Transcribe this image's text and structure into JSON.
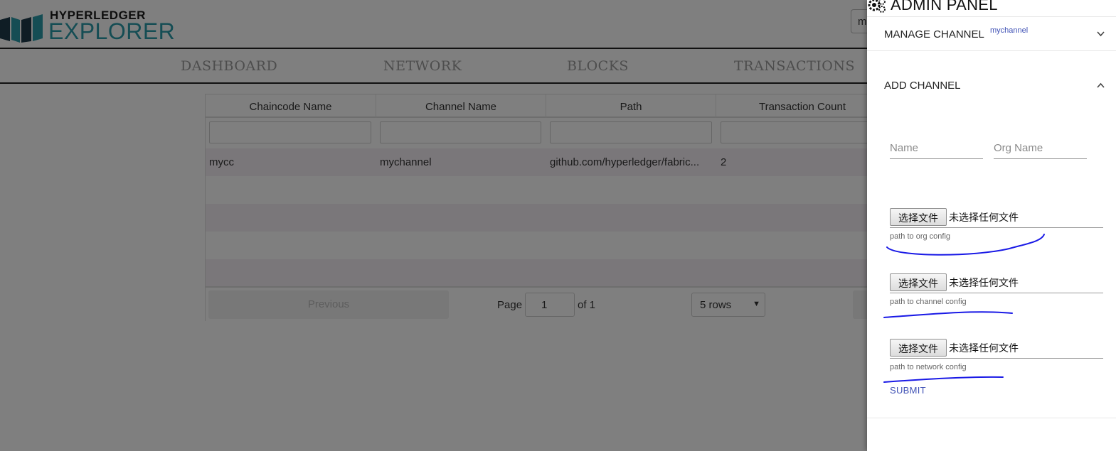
{
  "app": {
    "brand_line1": "HYPERLEDGER",
    "brand_line2": "EXPLORER",
    "search_value": "m"
  },
  "nav": {
    "items": [
      "DASHBOARD",
      "NETWORK",
      "BLOCKS",
      "TRANSACTIONS"
    ]
  },
  "table": {
    "headers": [
      "Chaincode Name",
      "Channel Name",
      "Path",
      "Transaction Count"
    ],
    "rows": [
      [
        "mycc",
        "mychannel",
        "github.com/hyperledger/fabric...",
        "2"
      ]
    ],
    "pagination": {
      "previous_label": "Previous",
      "page_label": "Page",
      "page_value": "1",
      "of_label": "of 1",
      "rows_selected": "5 rows"
    }
  },
  "drawer": {
    "title": "ADMIN PANEL",
    "manage_title": "MANAGE CHANNEL",
    "manage_channel": "mychannel",
    "add_title": "ADD CHANNEL",
    "name_placeholder": "Name",
    "org_placeholder": "Org Name",
    "files": [
      {
        "button": "选择文件",
        "status": "未选择任何文件",
        "hint": "path to org config"
      },
      {
        "button": "选择文件",
        "status": "未选择任何文件",
        "hint": "path to channel config"
      },
      {
        "button": "选择文件",
        "status": "未选择任何文件",
        "hint": "path to network config"
      }
    ],
    "submit_label": "SUBMIT"
  },
  "colors": {
    "brand_teal": "#2a9aa8",
    "link_blue": "#3f51b5",
    "annotation_blue": "#1a1ae6",
    "row_stripe": "#f4eef5"
  },
  "icons": [
    "logo-books-icon",
    "gear-icon",
    "chevron-down-icon",
    "chevron-up-icon",
    "select-caret-icon"
  ]
}
